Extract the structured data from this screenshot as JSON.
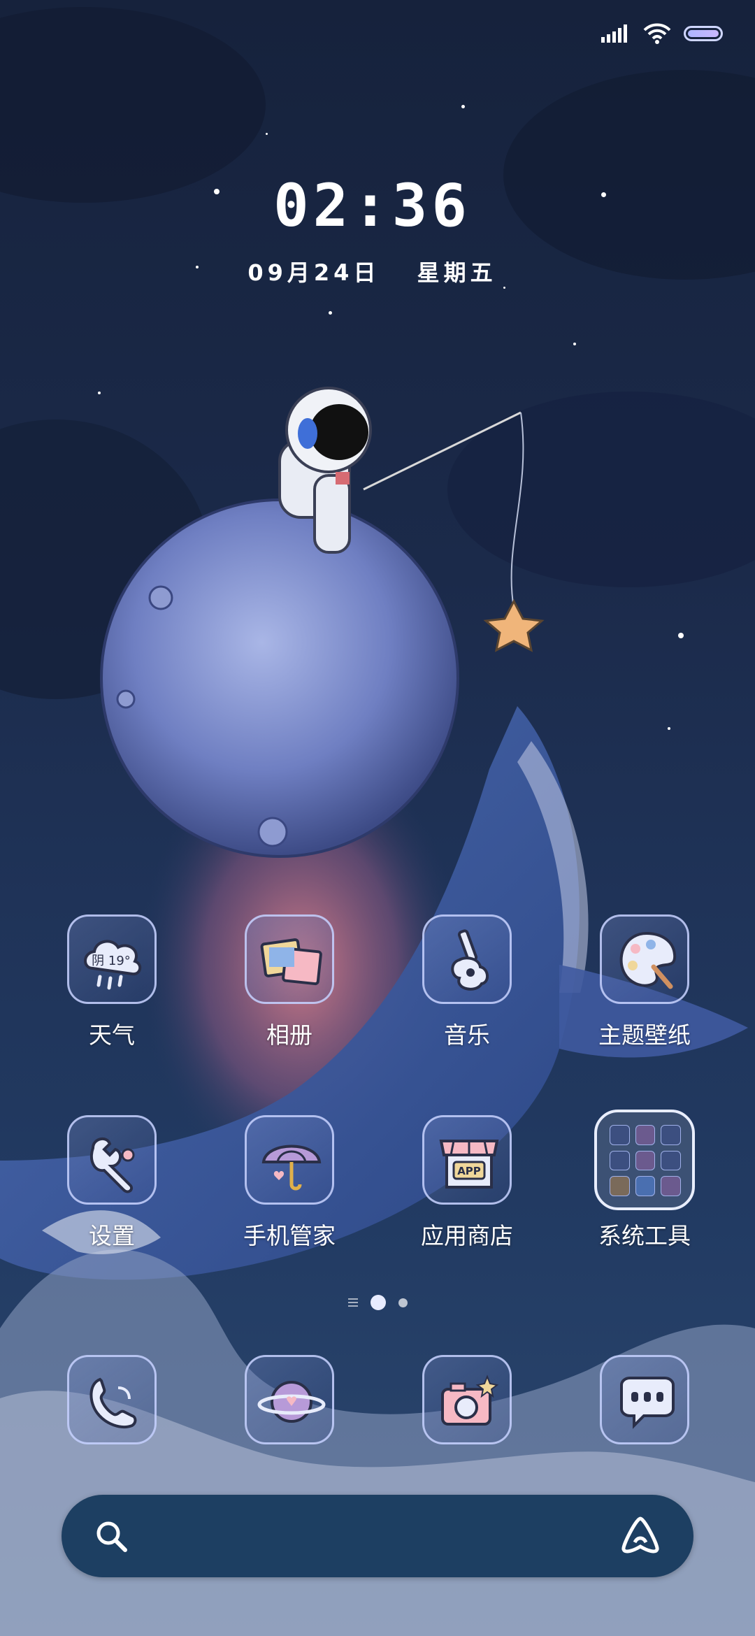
{
  "status_bar": {
    "signal_icon": "signal-bars-icon",
    "wifi_icon": "wifi-icon",
    "battery_icon": "battery-icon"
  },
  "lockclock": {
    "time": "02:36",
    "date": "09月24日",
    "weekday": "星期五"
  },
  "apps_row1": [
    {
      "label": "天气",
      "icon": "weather-cloud-icon",
      "badge": "阴 19°"
    },
    {
      "label": "相册",
      "icon": "gallery-photos-icon"
    },
    {
      "label": "音乐",
      "icon": "guitar-icon"
    },
    {
      "label": "主题壁纸",
      "icon": "palette-icon"
    }
  ],
  "apps_row2": [
    {
      "label": "设置",
      "icon": "wrench-icon"
    },
    {
      "label": "手机管家",
      "icon": "umbrella-icon"
    },
    {
      "label": "应用商店",
      "icon": "app-store-icon",
      "badge": "APP"
    },
    {
      "label": "系统工具",
      "icon": "folder-icon"
    }
  ],
  "dock": [
    {
      "icon": "phone-icon"
    },
    {
      "icon": "planet-browser-icon"
    },
    {
      "icon": "camera-icon"
    },
    {
      "icon": "messages-icon"
    }
  ],
  "search": {
    "left_icon": "search-icon",
    "right_icon": "assistant-icon"
  },
  "colors": {
    "accent": "#cfd6ff",
    "search_bar": "#1d3f62",
    "icon_border": "#c8d2ff"
  }
}
